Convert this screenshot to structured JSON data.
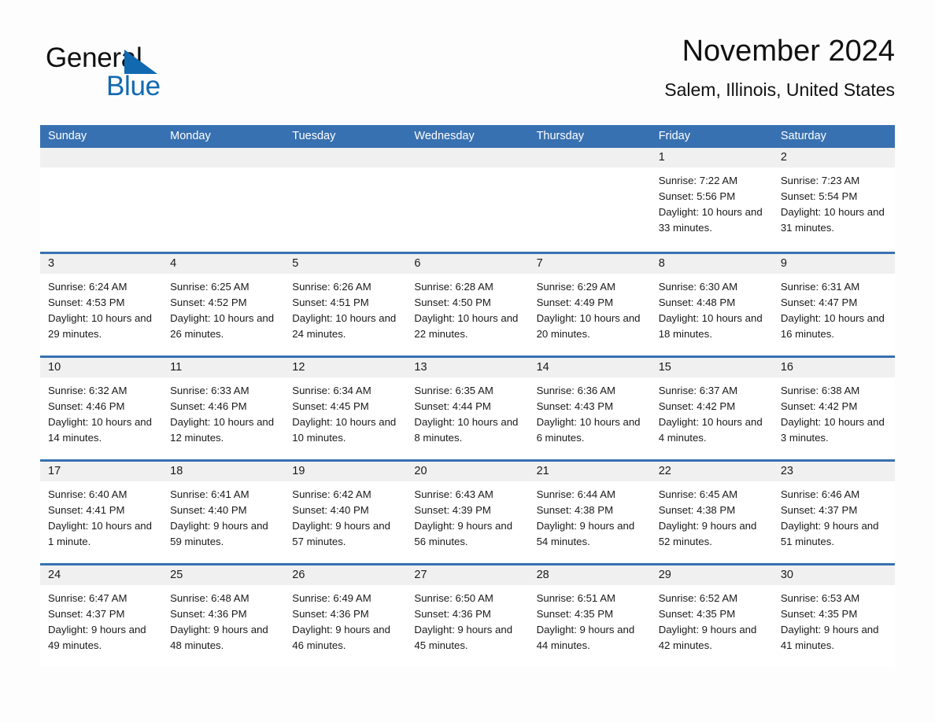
{
  "brand": {
    "line1": "General",
    "line2": "Blue",
    "triangle_color": "#1269b0"
  },
  "header": {
    "title": "November 2024",
    "subtitle": "Salem, Illinois, United States"
  },
  "theme": {
    "header_blue": "#3871b1",
    "day_band_gray": "#f0f0f0",
    "page_background": "#fdfdfd",
    "text": "#1a1a1a"
  },
  "weekdays": [
    "Sunday",
    "Monday",
    "Tuesday",
    "Wednesday",
    "Thursday",
    "Friday",
    "Saturday"
  ],
  "labels": {
    "sunrise_prefix": "Sunrise:",
    "sunset_prefix": "Sunset:",
    "daylight_prefix": "Daylight:"
  },
  "weeks": [
    [
      {
        "date": "",
        "empty": true
      },
      {
        "date": "",
        "empty": true
      },
      {
        "date": "",
        "empty": true
      },
      {
        "date": "",
        "empty": true
      },
      {
        "date": "",
        "empty": true
      },
      {
        "date": "1",
        "sunrise": "Sunrise: 7:22 AM",
        "sunset": "Sunset: 5:56 PM",
        "daylight": "Daylight: 10 hours and 33 minutes."
      },
      {
        "date": "2",
        "sunrise": "Sunrise: 7:23 AM",
        "sunset": "Sunset: 5:54 PM",
        "daylight": "Daylight: 10 hours and 31 minutes."
      }
    ],
    [
      {
        "date": "3",
        "sunrise": "Sunrise: 6:24 AM",
        "sunset": "Sunset: 4:53 PM",
        "daylight": "Daylight: 10 hours and 29 minutes."
      },
      {
        "date": "4",
        "sunrise": "Sunrise: 6:25 AM",
        "sunset": "Sunset: 4:52 PM",
        "daylight": "Daylight: 10 hours and 26 minutes."
      },
      {
        "date": "5",
        "sunrise": "Sunrise: 6:26 AM",
        "sunset": "Sunset: 4:51 PM",
        "daylight": "Daylight: 10 hours and 24 minutes."
      },
      {
        "date": "6",
        "sunrise": "Sunrise: 6:28 AM",
        "sunset": "Sunset: 4:50 PM",
        "daylight": "Daylight: 10 hours and 22 minutes."
      },
      {
        "date": "7",
        "sunrise": "Sunrise: 6:29 AM",
        "sunset": "Sunset: 4:49 PM",
        "daylight": "Daylight: 10 hours and 20 minutes."
      },
      {
        "date": "8",
        "sunrise": "Sunrise: 6:30 AM",
        "sunset": "Sunset: 4:48 PM",
        "daylight": "Daylight: 10 hours and 18 minutes."
      },
      {
        "date": "9",
        "sunrise": "Sunrise: 6:31 AM",
        "sunset": "Sunset: 4:47 PM",
        "daylight": "Daylight: 10 hours and 16 minutes."
      }
    ],
    [
      {
        "date": "10",
        "sunrise": "Sunrise: 6:32 AM",
        "sunset": "Sunset: 4:46 PM",
        "daylight": "Daylight: 10 hours and 14 minutes."
      },
      {
        "date": "11",
        "sunrise": "Sunrise: 6:33 AM",
        "sunset": "Sunset: 4:46 PM",
        "daylight": "Daylight: 10 hours and 12 minutes."
      },
      {
        "date": "12",
        "sunrise": "Sunrise: 6:34 AM",
        "sunset": "Sunset: 4:45 PM",
        "daylight": "Daylight: 10 hours and 10 minutes."
      },
      {
        "date": "13",
        "sunrise": "Sunrise: 6:35 AM",
        "sunset": "Sunset: 4:44 PM",
        "daylight": "Daylight: 10 hours and 8 minutes."
      },
      {
        "date": "14",
        "sunrise": "Sunrise: 6:36 AM",
        "sunset": "Sunset: 4:43 PM",
        "daylight": "Daylight: 10 hours and 6 minutes."
      },
      {
        "date": "15",
        "sunrise": "Sunrise: 6:37 AM",
        "sunset": "Sunset: 4:42 PM",
        "daylight": "Daylight: 10 hours and 4 minutes."
      },
      {
        "date": "16",
        "sunrise": "Sunrise: 6:38 AM",
        "sunset": "Sunset: 4:42 PM",
        "daylight": "Daylight: 10 hours and 3 minutes."
      }
    ],
    [
      {
        "date": "17",
        "sunrise": "Sunrise: 6:40 AM",
        "sunset": "Sunset: 4:41 PM",
        "daylight": "Daylight: 10 hours and 1 minute."
      },
      {
        "date": "18",
        "sunrise": "Sunrise: 6:41 AM",
        "sunset": "Sunset: 4:40 PM",
        "daylight": "Daylight: 9 hours and 59 minutes."
      },
      {
        "date": "19",
        "sunrise": "Sunrise: 6:42 AM",
        "sunset": "Sunset: 4:40 PM",
        "daylight": "Daylight: 9 hours and 57 minutes."
      },
      {
        "date": "20",
        "sunrise": "Sunrise: 6:43 AM",
        "sunset": "Sunset: 4:39 PM",
        "daylight": "Daylight: 9 hours and 56 minutes."
      },
      {
        "date": "21",
        "sunrise": "Sunrise: 6:44 AM",
        "sunset": "Sunset: 4:38 PM",
        "daylight": "Daylight: 9 hours and 54 minutes."
      },
      {
        "date": "22",
        "sunrise": "Sunrise: 6:45 AM",
        "sunset": "Sunset: 4:38 PM",
        "daylight": "Daylight: 9 hours and 52 minutes."
      },
      {
        "date": "23",
        "sunrise": "Sunrise: 6:46 AM",
        "sunset": "Sunset: 4:37 PM",
        "daylight": "Daylight: 9 hours and 51 minutes."
      }
    ],
    [
      {
        "date": "24",
        "sunrise": "Sunrise: 6:47 AM",
        "sunset": "Sunset: 4:37 PM",
        "daylight": "Daylight: 9 hours and 49 minutes."
      },
      {
        "date": "25",
        "sunrise": "Sunrise: 6:48 AM",
        "sunset": "Sunset: 4:36 PM",
        "daylight": "Daylight: 9 hours and 48 minutes."
      },
      {
        "date": "26",
        "sunrise": "Sunrise: 6:49 AM",
        "sunset": "Sunset: 4:36 PM",
        "daylight": "Daylight: 9 hours and 46 minutes."
      },
      {
        "date": "27",
        "sunrise": "Sunrise: 6:50 AM",
        "sunset": "Sunset: 4:36 PM",
        "daylight": "Daylight: 9 hours and 45 minutes."
      },
      {
        "date": "28",
        "sunrise": "Sunrise: 6:51 AM",
        "sunset": "Sunset: 4:35 PM",
        "daylight": "Daylight: 9 hours and 44 minutes."
      },
      {
        "date": "29",
        "sunrise": "Sunrise: 6:52 AM",
        "sunset": "Sunset: 4:35 PM",
        "daylight": "Daylight: 9 hours and 42 minutes."
      },
      {
        "date": "30",
        "sunrise": "Sunrise: 6:53 AM",
        "sunset": "Sunset: 4:35 PM",
        "daylight": "Daylight: 9 hours and 41 minutes."
      }
    ]
  ]
}
